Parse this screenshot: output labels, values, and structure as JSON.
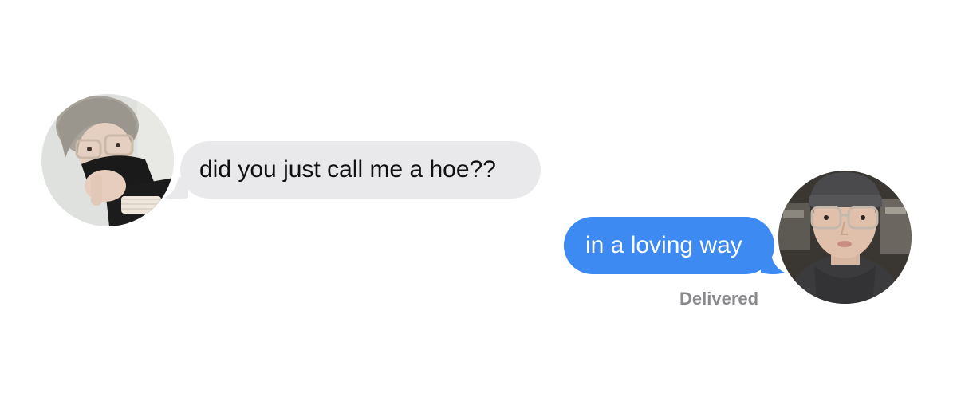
{
  "conversation": {
    "received": {
      "text": "did you just call me a hoe??",
      "bubble_color": "#e9e9eb",
      "text_color": "#111111"
    },
    "sent": {
      "text": "in a loving way",
      "bubble_color": "#3c8af2",
      "text_color": "#ffffff",
      "status": "Delivered"
    }
  },
  "avatars": {
    "left": "contact-photo",
    "right": "user-photo"
  }
}
